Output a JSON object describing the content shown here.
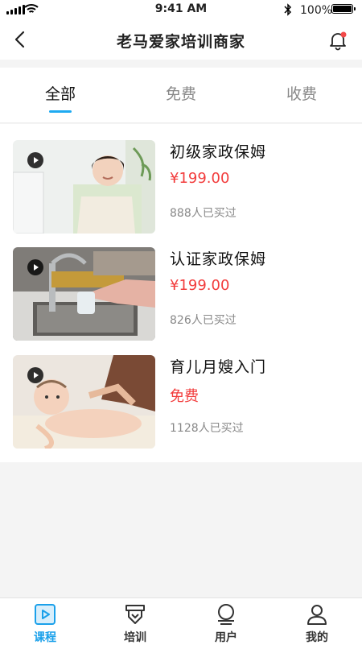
{
  "status_bar": {
    "time": "9:41 AM",
    "battery": "100%"
  },
  "header": {
    "title": "老马爱家培训商家"
  },
  "tabs": [
    {
      "label": "全部",
      "active": true
    },
    {
      "label": "免费",
      "active": false
    },
    {
      "label": "收费",
      "active": false
    }
  ],
  "courses": [
    {
      "name": "初级家政保姆",
      "price": "¥199.00",
      "buyers": "888人已买过"
    },
    {
      "name": "认证家政保姆",
      "price": "¥199.00",
      "buyers": "826人已买过"
    },
    {
      "name": "育儿月嫂入门",
      "price": "免费",
      "buyers": "1128人已买过"
    }
  ],
  "bottom_nav": [
    {
      "label": "课程",
      "icon": "course-play-icon",
      "active": true
    },
    {
      "label": "培训",
      "icon": "training-icon",
      "active": false
    },
    {
      "label": "用户",
      "icon": "users-icon",
      "active": false
    },
    {
      "label": "我的",
      "icon": "profile-icon",
      "active": false
    }
  ],
  "colors": {
    "accent": "#1aa0ea",
    "price": "#f23c3c",
    "notification_dot": "#f24949"
  }
}
